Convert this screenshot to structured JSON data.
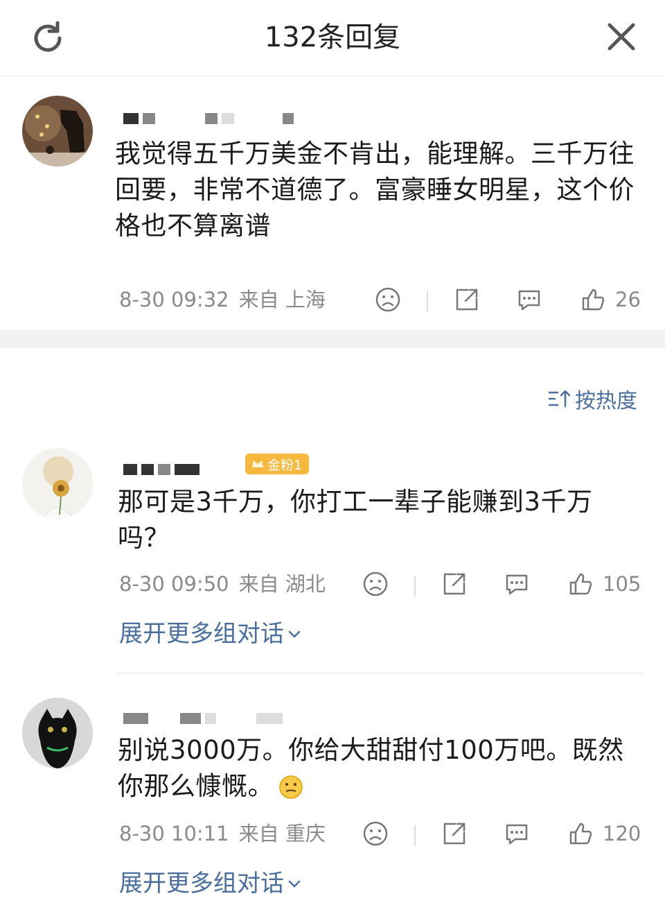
{
  "header": {
    "title": "132条回复",
    "refresh_icon": "refresh-icon",
    "close_icon": "close-icon"
  },
  "root_comment": {
    "text": "我觉得五千万美金不肯出，能理解。三千万往回要，非常不道德了。富豪睡女明星，这个价格也不算离谱",
    "time": "8-30 09:32",
    "location": "来自 上海",
    "likes": "26"
  },
  "sort": {
    "label": "按热度"
  },
  "replies": [
    {
      "badge": "金粉1",
      "text": "那可是3千万，你打工一辈子能赚到3千万吗？",
      "time": "8-30 09:50",
      "location": "来自 湖北",
      "likes": "105",
      "expand": "展开更多组对话"
    },
    {
      "text": "别说3000万。你给大甜甜付100万吧。既然你那么慷慨。",
      "time": "8-30 10:11",
      "location": "来自 重庆",
      "likes": "120",
      "expand": "展开更多组对话"
    }
  ],
  "colors": {
    "link_blue": "#4a6e9e",
    "meta_gray": "#8a8a8a",
    "badge_gold": "#f6b93d"
  }
}
